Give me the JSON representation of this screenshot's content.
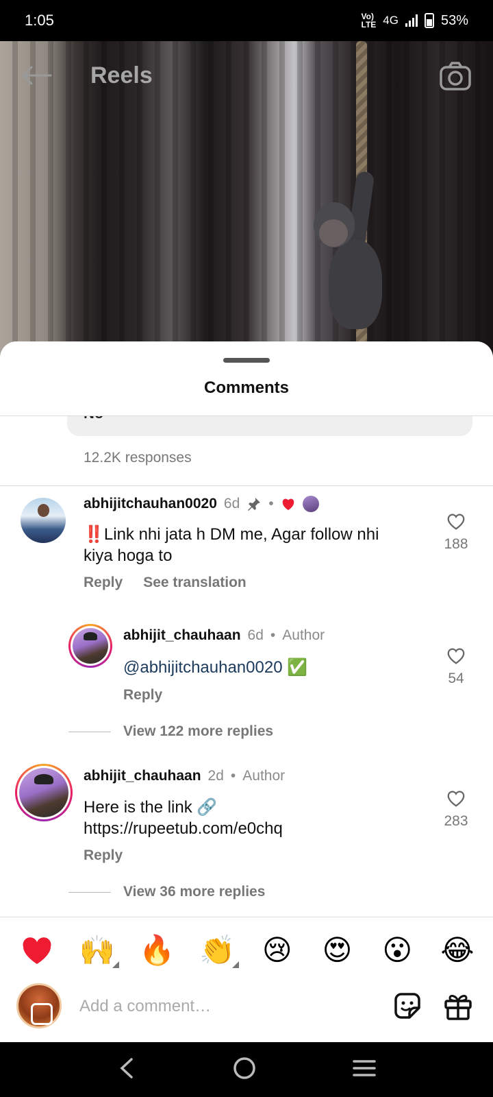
{
  "status_bar": {
    "time": "1:05",
    "network": "4G",
    "volte": "VoLTE",
    "battery": "53%"
  },
  "reels_header": {
    "title": "Reels",
    "back_icon": "arrow-left-icon",
    "camera_icon": "camera-icon"
  },
  "comments": {
    "title": "Comments",
    "poll_option_partial": "No",
    "responses": "12.2K responses",
    "items": [
      {
        "username": "abhijitchauhan0020",
        "time": "6d",
        "pinned": true,
        "liked_by_author": true,
        "text": "‼️Link nhi jata h DM me, Agar follow nhi kiya hoga to",
        "reply_label": "Reply",
        "translate_label": "See translation",
        "likes": "188"
      },
      {
        "username": "abhijit_chauhaan",
        "time": "6d",
        "role": "Author",
        "mention": "@abhijitchauhan0020",
        "text_suffix": "✅",
        "reply_label": "Reply",
        "likes": "54"
      },
      {
        "username": "abhijit_chauhaan",
        "time": "2d",
        "role": "Author",
        "text_line1": "Here is the link 🔗",
        "text_line2": "https://rupeetub.com/e0chq",
        "reply_label": "Reply",
        "likes": "283"
      }
    ],
    "view_more_1": "View 122 more replies",
    "view_more_2": "View 36 more replies",
    "separator": "•"
  },
  "emoji_bar": [
    "❤️",
    "🙌",
    "🔥",
    "👏",
    "😢",
    "😍",
    "😮",
    "😂"
  ],
  "comment_input": {
    "placeholder": "Add a comment…"
  },
  "colors": {
    "heart_red": "#ed1c33",
    "link_blue": "#1b3a5c",
    "grey_text": "#777777"
  }
}
